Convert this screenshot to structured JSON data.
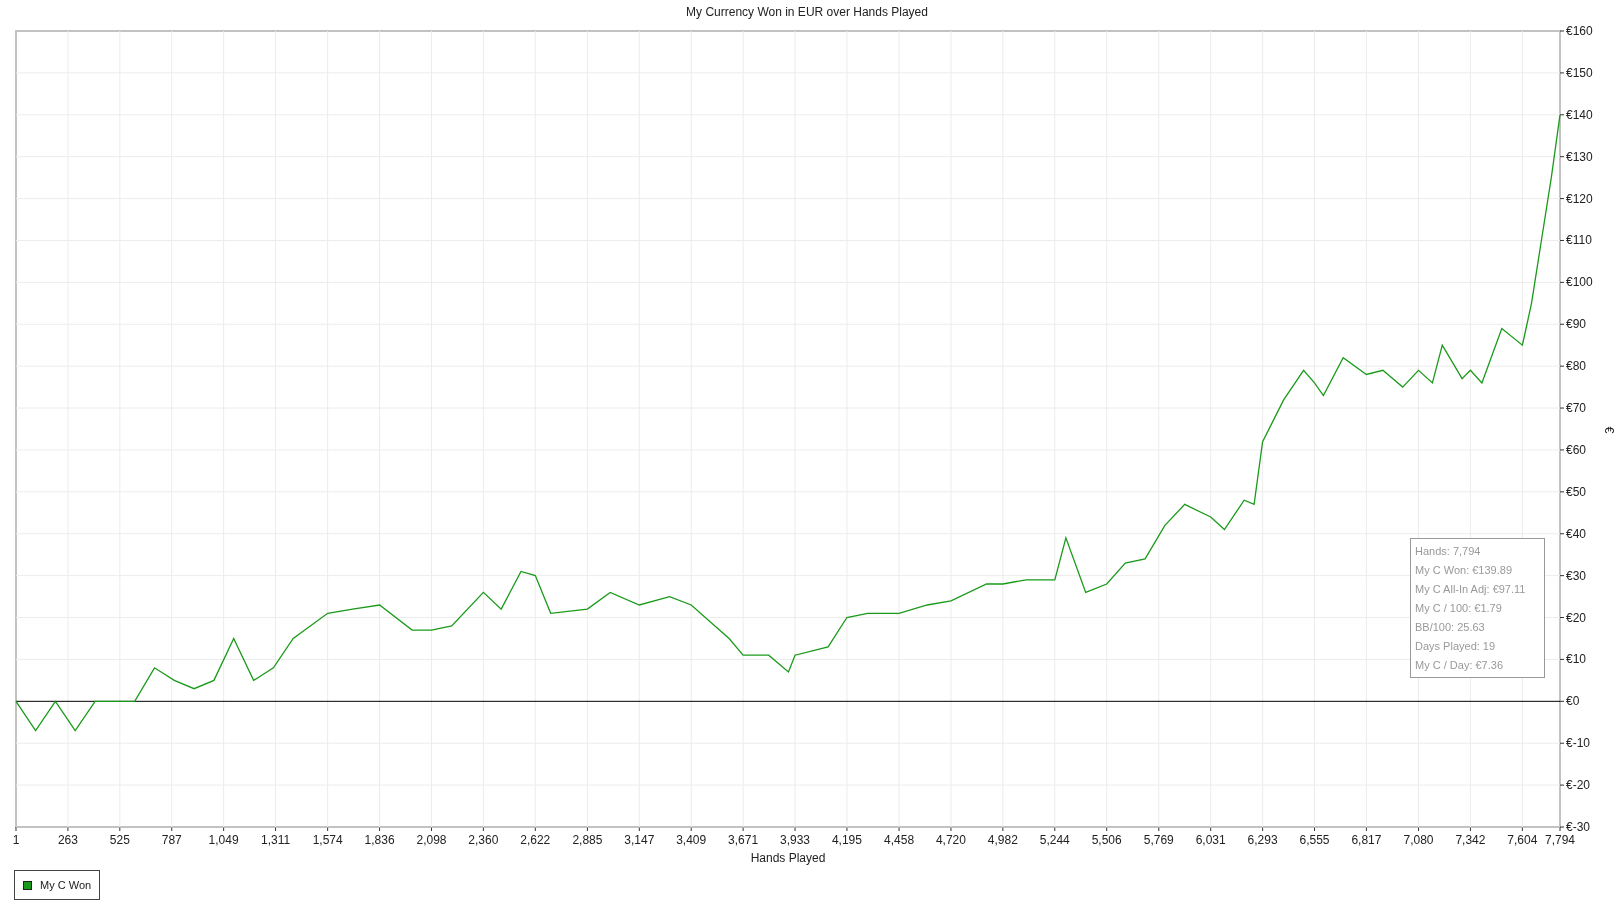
{
  "chart_data": {
    "type": "line",
    "title": "My Currency Won in EUR over Hands Played",
    "xlabel": "Hands Played",
    "ylabel": "€",
    "x": [
      1,
      100,
      200,
      300,
      400,
      600,
      700,
      800,
      900,
      1000,
      1100,
      1200,
      1300,
      1400,
      1574,
      1700,
      1836,
      2000,
      2098,
      2200,
      2360,
      2450,
      2550,
      2622,
      2700,
      2885,
      3000,
      3147,
      3300,
      3409,
      3600,
      3671,
      3800,
      3900,
      3933,
      4100,
      4195,
      4300,
      4458,
      4600,
      4720,
      4900,
      4982,
      5100,
      5244,
      5300,
      5400,
      5506,
      5600,
      5700,
      5800,
      5900,
      6031,
      6100,
      6200,
      6250,
      6293,
      6400,
      6500,
      6555,
      6600,
      6700,
      6817,
      6900,
      7000,
      7080,
      7150,
      7200,
      7300,
      7342,
      7400,
      7500,
      7604,
      7650,
      7700,
      7750,
      7794
    ],
    "series": [
      {
        "name": "My C Won",
        "color": "#1a9a1a",
        "values": [
          0,
          -7,
          0,
          -7,
          0,
          0,
          8,
          5,
          3,
          5,
          15,
          5,
          8,
          15,
          21,
          22,
          23,
          17,
          17,
          18,
          26,
          22,
          31,
          30,
          21,
          22,
          26,
          23,
          25,
          23,
          15,
          11,
          11,
          7,
          11,
          13,
          20,
          21,
          21,
          23,
          24,
          28,
          28,
          29,
          29,
          39,
          26,
          28,
          33,
          34,
          42,
          47,
          44,
          41,
          48,
          47,
          62,
          72,
          79,
          76,
          73,
          82,
          78,
          79,
          75,
          79,
          76,
          85,
          77,
          79,
          76,
          89,
          85,
          95,
          110,
          125,
          140
        ]
      }
    ],
    "grid": true,
    "xlim": [
      1,
      7794
    ],
    "ylim": [
      -30,
      160
    ],
    "xticks": [
      {
        "value": 1,
        "label": "1"
      },
      {
        "value": 263,
        "label": "263"
      },
      {
        "value": 525,
        "label": "525"
      },
      {
        "value": 787,
        "label": "787"
      },
      {
        "value": 1049,
        "label": "1,049"
      },
      {
        "value": 1311,
        "label": "1,311"
      },
      {
        "value": 1574,
        "label": "1,574"
      },
      {
        "value": 1836,
        "label": "1,836"
      },
      {
        "value": 2098,
        "label": "2,098"
      },
      {
        "value": 2360,
        "label": "2,360"
      },
      {
        "value": 2622,
        "label": "2,622"
      },
      {
        "value": 2885,
        "label": "2,885"
      },
      {
        "value": 3147,
        "label": "3,147"
      },
      {
        "value": 3409,
        "label": "3,409"
      },
      {
        "value": 3671,
        "label": "3,671"
      },
      {
        "value": 3933,
        "label": "3,933"
      },
      {
        "value": 4195,
        "label": "4,195"
      },
      {
        "value": 4458,
        "label": "4,458"
      },
      {
        "value": 4720,
        "label": "4,720"
      },
      {
        "value": 4982,
        "label": "4,982"
      },
      {
        "value": 5244,
        "label": "5,244"
      },
      {
        "value": 5506,
        "label": "5,506"
      },
      {
        "value": 5769,
        "label": "5,769"
      },
      {
        "value": 6031,
        "label": "6,031"
      },
      {
        "value": 6293,
        "label": "6,293"
      },
      {
        "value": 6555,
        "label": "6,555"
      },
      {
        "value": 6817,
        "label": "6,817"
      },
      {
        "value": 7080,
        "label": "7,080"
      },
      {
        "value": 7342,
        "label": "7,342"
      },
      {
        "value": 7604,
        "label": "7,604"
      },
      {
        "value": 7794,
        "label": "7,794"
      }
    ],
    "yticks": [
      {
        "value": 160,
        "label": "€160"
      },
      {
        "value": 150,
        "label": "€150"
      },
      {
        "value": 140,
        "label": "€140"
      },
      {
        "value": 130,
        "label": "€130"
      },
      {
        "value": 120,
        "label": "€120"
      },
      {
        "value": 110,
        "label": "€110"
      },
      {
        "value": 100,
        "label": "€100"
      },
      {
        "value": 90,
        "label": "€90"
      },
      {
        "value": 80,
        "label": "€80"
      },
      {
        "value": 70,
        "label": "€70"
      },
      {
        "value": 60,
        "label": "€60"
      },
      {
        "value": 50,
        "label": "€50"
      },
      {
        "value": 40,
        "label": "€40"
      },
      {
        "value": 30,
        "label": "€30"
      },
      {
        "value": 20,
        "label": "€20"
      },
      {
        "value": 10,
        "label": "€10"
      },
      {
        "value": 0,
        "label": "€0"
      },
      {
        "value": -10,
        "label": "€-10"
      },
      {
        "value": -20,
        "label": "€-20"
      },
      {
        "value": -30,
        "label": "€-30"
      }
    ]
  },
  "stats": [
    "Hands: 7,794",
    "My C Won: €139.89",
    "My C All-In Adj: €97.11",
    "My C / 100: €1.79",
    "BB/100: 25.63",
    "Days Played: 19",
    "My C / Day: €7.36"
  ]
}
